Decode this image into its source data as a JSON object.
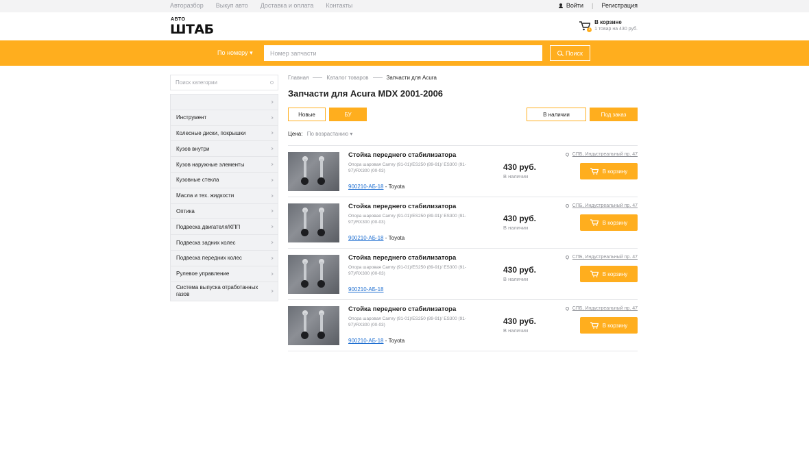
{
  "topnav": {
    "links": [
      "Авторазбор",
      "Выкуп авто",
      "Доставка и оплата",
      "Контакты"
    ],
    "login": "Войти",
    "register": "Регистрация"
  },
  "header": {
    "logo_small": "АВТО",
    "logo_big": "ШТАБ",
    "cart_title": "В корзине",
    "cart_sub": "1 товар на 430 руб.",
    "cart_badge": "1"
  },
  "search": {
    "mode": "По номеру",
    "placeholder": "Номер запчасти",
    "button": "Поиск"
  },
  "sidebar": {
    "search_placeholder": "Поиск категории",
    "items": [
      "",
      "Инструмент",
      "Колесные диски, покрышки",
      "Кузов внутри",
      "Кузов наружные элементы",
      "Кузовные стекла",
      "Масла и тех. жидкости",
      "Оптика",
      "Подвеска двигателя/КПП",
      "Подвеска задних колес",
      "Подвеска передних колес",
      "Рулевое управление",
      "Система выпуска отработанных газов"
    ]
  },
  "breadcrumb": [
    "Главная",
    "Каталог товаров",
    "Запчасти для Acura"
  ],
  "page_title": "Запчасти для Acura MDX 2001-2006",
  "filters": {
    "new": "Новые",
    "used": "БУ",
    "in_stock": "В наличии",
    "on_order": "Под заказ"
  },
  "sort": {
    "label": "Цена:",
    "value": "По возрастанию"
  },
  "products": [
    {
      "name": "Стойка переднего стабилизатора",
      "desc": "Опора шаровая Camry (91-01)/ES250 (89-91)/ ES300 (91-97)/RX300 (00-03)",
      "code": "900210-АБ-18",
      "brand": "- Toyota",
      "price": "430 руб.",
      "stock": "В наличии",
      "location": "СПБ, Индустреальный пр. 47",
      "cart": "В корзину"
    },
    {
      "name": "Стойка переднего стабилизатора",
      "desc": "Опора шаровая Camry (91-01)/ES250 (89-91)/ ES300 (91-97)/RX300 (00-03)",
      "code": "900210-АБ-18",
      "brand": "- Toyota",
      "price": "430 руб.",
      "stock": "В наличии",
      "location": "СПБ, Индустреальный пр. 47",
      "cart": "В корзину"
    },
    {
      "name": "Стойка переднего стабилизатора",
      "desc": "Опора шаровая Camry (91-01)/ES250 (89-91)/ ES300 (91-97)/RX300 (00-03)",
      "code": "900210-АБ-18",
      "brand": "",
      "price": "430 руб.",
      "stock": "В наличии",
      "location": "СПБ, Индустреальный пр. 47",
      "cart": "В корзину"
    },
    {
      "name": "Стойка переднего стабилизатора",
      "desc": "Опора шаровая Camry (91-01)/ES250 (89-91)/ ES300 (91-97)/RX300 (00-03)",
      "code": "900210-АБ-18",
      "brand": "- Toyota",
      "price": "430 руб.",
      "stock": "В наличии",
      "location": "СПБ, Индустреальный пр. 47",
      "cart": "В корзину"
    }
  ],
  "colors": {
    "accent": "#ffae1e",
    "link": "#1f6fd1"
  }
}
